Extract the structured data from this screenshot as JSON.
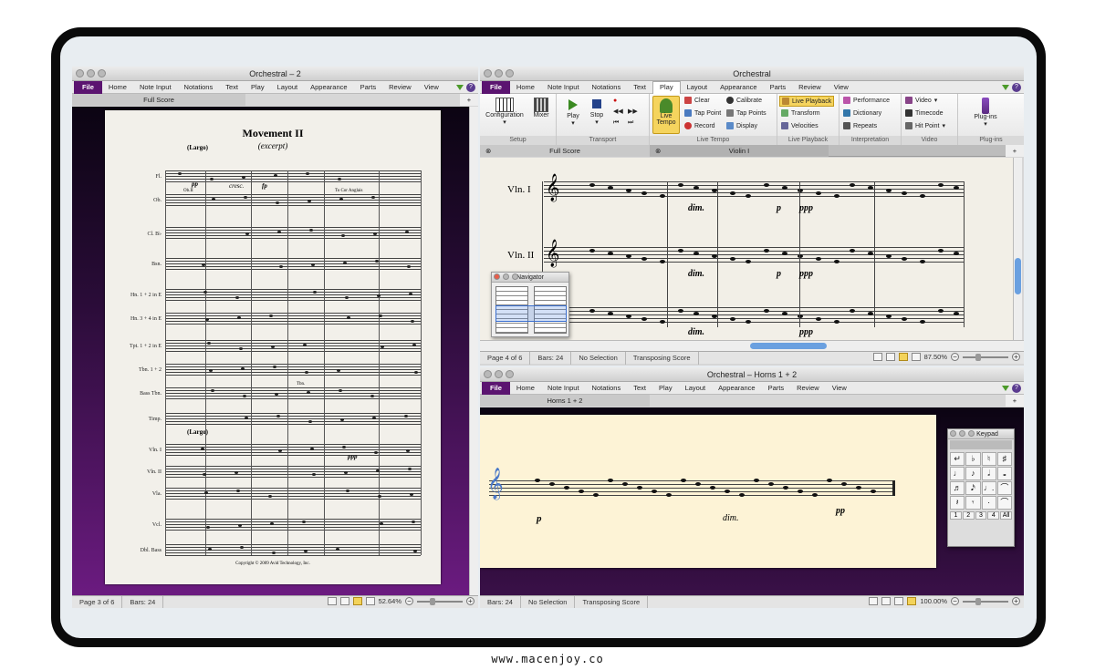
{
  "footer_url": "www.macenjoy.co",
  "left_window": {
    "title": "Orchestral – 2",
    "menu": [
      "File",
      "Home",
      "Note Input",
      "Notations",
      "Text",
      "Play",
      "Layout",
      "Appearance",
      "Parts",
      "Review",
      "View"
    ],
    "tab": "Full Score",
    "page": {
      "title": "Movement II",
      "subtitle": "(excerpt)",
      "tempo": "(Largo)",
      "tempo2": "(Largo)",
      "instruments": [
        "Fl.",
        "Ob.",
        "Cl. B♭",
        "Bsn.",
        "Hn. 1 + 2 in E",
        "Hn. 3 + 4 in E",
        "Tpt. 1 + 2 in E",
        "Tbn. 1 + 2",
        "Bass Tbn.",
        "Timp.",
        "Vln. I",
        "Vln. II",
        "Vla.",
        "Vcl.",
        "Dbl. Bass"
      ],
      "markings": [
        "pp",
        "cresc.",
        "fp",
        "To Cor Anglais",
        "Ob.II",
        "Tbn.",
        "ppp"
      ],
      "copyright": "Copyright © 2009 Avid Technology, Inc."
    },
    "status": {
      "page": "Page 3 of 6",
      "bars": "Bars: 24",
      "zoom": "52.64%"
    }
  },
  "right_top_window": {
    "title": "Orchestral",
    "menu": [
      "File",
      "Home",
      "Note Input",
      "Notations",
      "Text",
      "Play",
      "Layout",
      "Appearance",
      "Parts",
      "Review",
      "View"
    ],
    "active_menu": "Play",
    "ribbon": {
      "setup": {
        "label": "Setup",
        "configuration": "Configuration",
        "mixer": "Mixer"
      },
      "transport": {
        "label": "Transport",
        "play": "Play",
        "stop": "Stop"
      },
      "live_tempo": {
        "label": "Live Tempo",
        "live_tempo_btn": "Live Tempo",
        "clear": "Clear",
        "tap_point": "Tap Point",
        "record": "Record",
        "calibrate": "Calibrate",
        "tap_points": "Tap Points",
        "display": "Display"
      },
      "live_playback": {
        "label": "Live Playback",
        "live_playback": "Live Playback",
        "transform": "Transform",
        "velocities": "Velocities"
      },
      "interpretation": {
        "label": "Interpretation",
        "performance": "Performance",
        "dictionary": "Dictionary",
        "repeats": "Repeats"
      },
      "video": {
        "label": "Video",
        "video": "Video",
        "timecode": "Timecode",
        "hit_point": "Hit Point"
      },
      "plugins": {
        "label": "Plug-ins",
        "plugins": "Plug-ins"
      }
    },
    "tabs": [
      "Full Score",
      "Violin I"
    ],
    "staves": [
      "Vln. I",
      "Vln. II"
    ],
    "dynamics": [
      "dim.",
      "p",
      "ppp",
      "dim.",
      "p",
      "ppp",
      "dim.",
      "ppp"
    ],
    "navigator_title": "Navigator",
    "status": {
      "page": "Page 4 of 6",
      "bars": "Bars: 24",
      "selection": "No Selection",
      "transposing": "Transposing Score",
      "zoom": "87.50%"
    }
  },
  "right_bottom_window": {
    "title": "Orchestral – Horns 1 + 2",
    "menu": [
      "File",
      "Home",
      "Note Input",
      "Notations",
      "Text",
      "Play",
      "Layout",
      "Appearance",
      "Parts",
      "Review",
      "View"
    ],
    "tab": "Horns 1 + 2",
    "dynamics": [
      "p",
      "dim.",
      "pp"
    ],
    "keypad": {
      "title": "Keypad",
      "keys": [
        "↵",
        "♭",
        "♮",
        "♯",
        "♩",
        "♪",
        "𝅗𝅥",
        "𝅝",
        "♬",
        "𝅘𝅥𝅯",
        "♩.",
        "⌒",
        "𝄽",
        "𝄾",
        "·",
        "⌒"
      ],
      "voices": [
        "1",
        "2",
        "3",
        "4",
        "All"
      ]
    },
    "status": {
      "bars": "Bars: 24",
      "selection": "No Selection",
      "transposing": "Transposing Score",
      "zoom": "100.00%"
    }
  },
  "colors": {
    "brand_purple": "#5b1470",
    "accent_yellow": "#f3d35a"
  }
}
